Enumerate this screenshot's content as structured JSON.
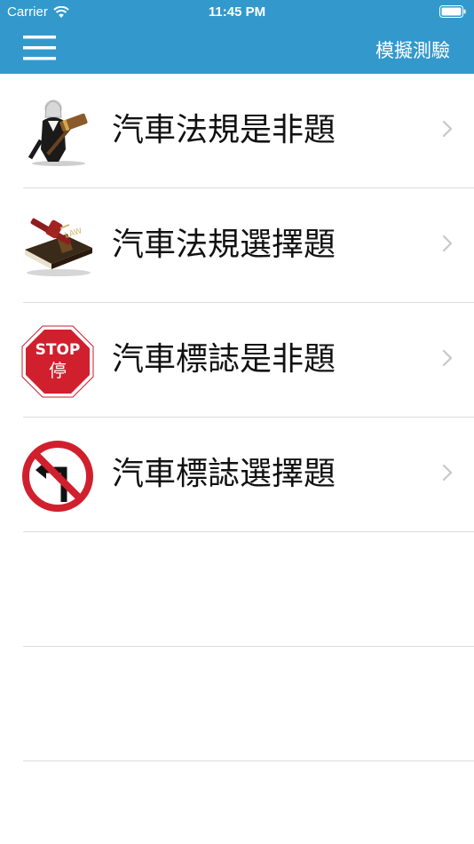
{
  "status_bar": {
    "carrier": "Carrier",
    "time": "11:45 PM",
    "wifi_icon": "wifi-icon",
    "battery_icon": "battery-full-icon"
  },
  "nav": {
    "menu_icon": "hamburger-menu-icon",
    "title": "模擬測驗"
  },
  "colors": {
    "header_bg": "#3399cc",
    "separator": "#dcdcdc",
    "chevron": "#c7c7cc"
  },
  "items": [
    {
      "label": "汽車法規是非題",
      "icon": "judge-gavel-icon"
    },
    {
      "label": "汽車法規選擇題",
      "icon": "law-book-gavel-icon"
    },
    {
      "label": "汽車標誌是非題",
      "icon": "stop-sign-icon"
    },
    {
      "label": "汽車標誌選擇題",
      "icon": "no-left-turn-sign-icon"
    }
  ]
}
